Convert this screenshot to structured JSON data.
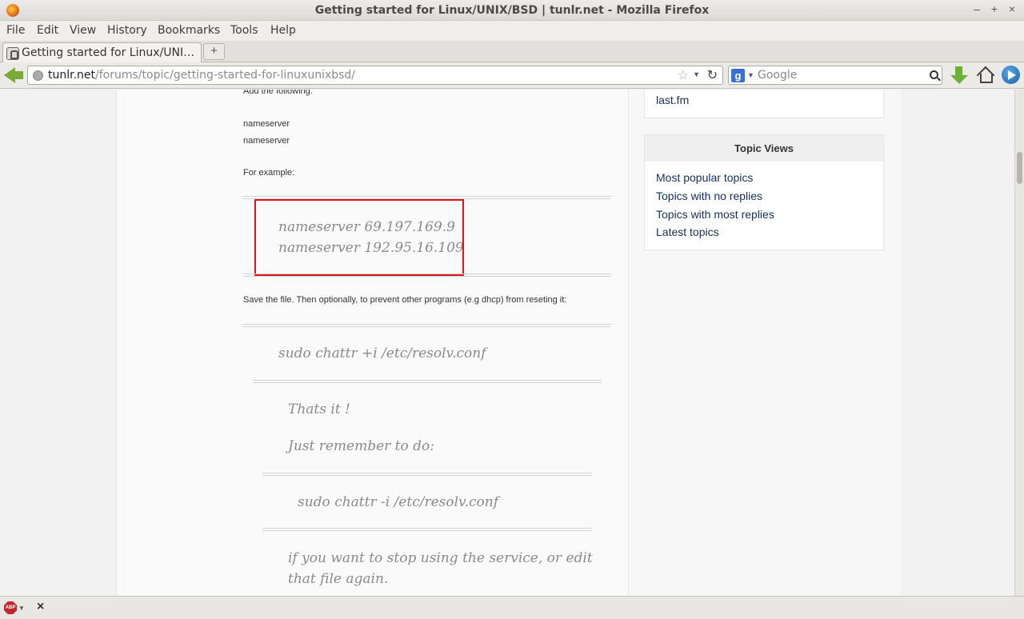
{
  "window": {
    "title": "Getting started for Linux/UNIX/BSD | tunlr.net - Mozilla Firefox",
    "minimize": "–",
    "maximize": "+",
    "close": "×"
  },
  "menu": [
    "File",
    "Edit",
    "View",
    "History",
    "Bookmarks",
    "Tools",
    "Help"
  ],
  "tab": {
    "label": "Getting started for Linux/UNI…",
    "new_tab": "+"
  },
  "navbar": {
    "url_host": "tunlr.net",
    "url_path": "/forums/topic/getting-started-for-linuxunixbsd/",
    "star": "☆",
    "dropdown": "▼",
    "reload": "↻",
    "search_engine_letter": "g",
    "search_placeholder": "Google"
  },
  "post": {
    "add_following": "Add the following:",
    "nameserver_1": "nameserver",
    "nameserver_2": "nameserver",
    "for_example": "For example:",
    "example_line_1": "nameserver 69.197.169.9",
    "example_line_2": "nameserver 192.95.16.109",
    "save_file": "Save the file. Then optionally, to prevent other programs (e.g dhcp) from reseting it:",
    "chattr_set": "sudo chattr +i /etc/resolv.conf",
    "thats_it": "Thats it !",
    "just_remember": "Just remember to do:",
    "chattr_unset": "sudo chattr -i /etc/resolv.conf",
    "stop_line_1": "if you want to stop using the service, or edit",
    "stop_line_2": "that file again."
  },
  "sidebar": {
    "lastfm": "last.fm",
    "topic_views": {
      "title": "Topic Views",
      "links": [
        "Most popular topics",
        "Topics with no replies",
        "Topics with most replies",
        "Latest topics"
      ]
    }
  },
  "addonbar": {
    "abp_label": "ABP",
    "abp_dropdown": "▼",
    "close": "×"
  },
  "colors": {
    "highlight": "#d9171c",
    "link": "#14305a",
    "quote_text": "#8a8a8a"
  }
}
